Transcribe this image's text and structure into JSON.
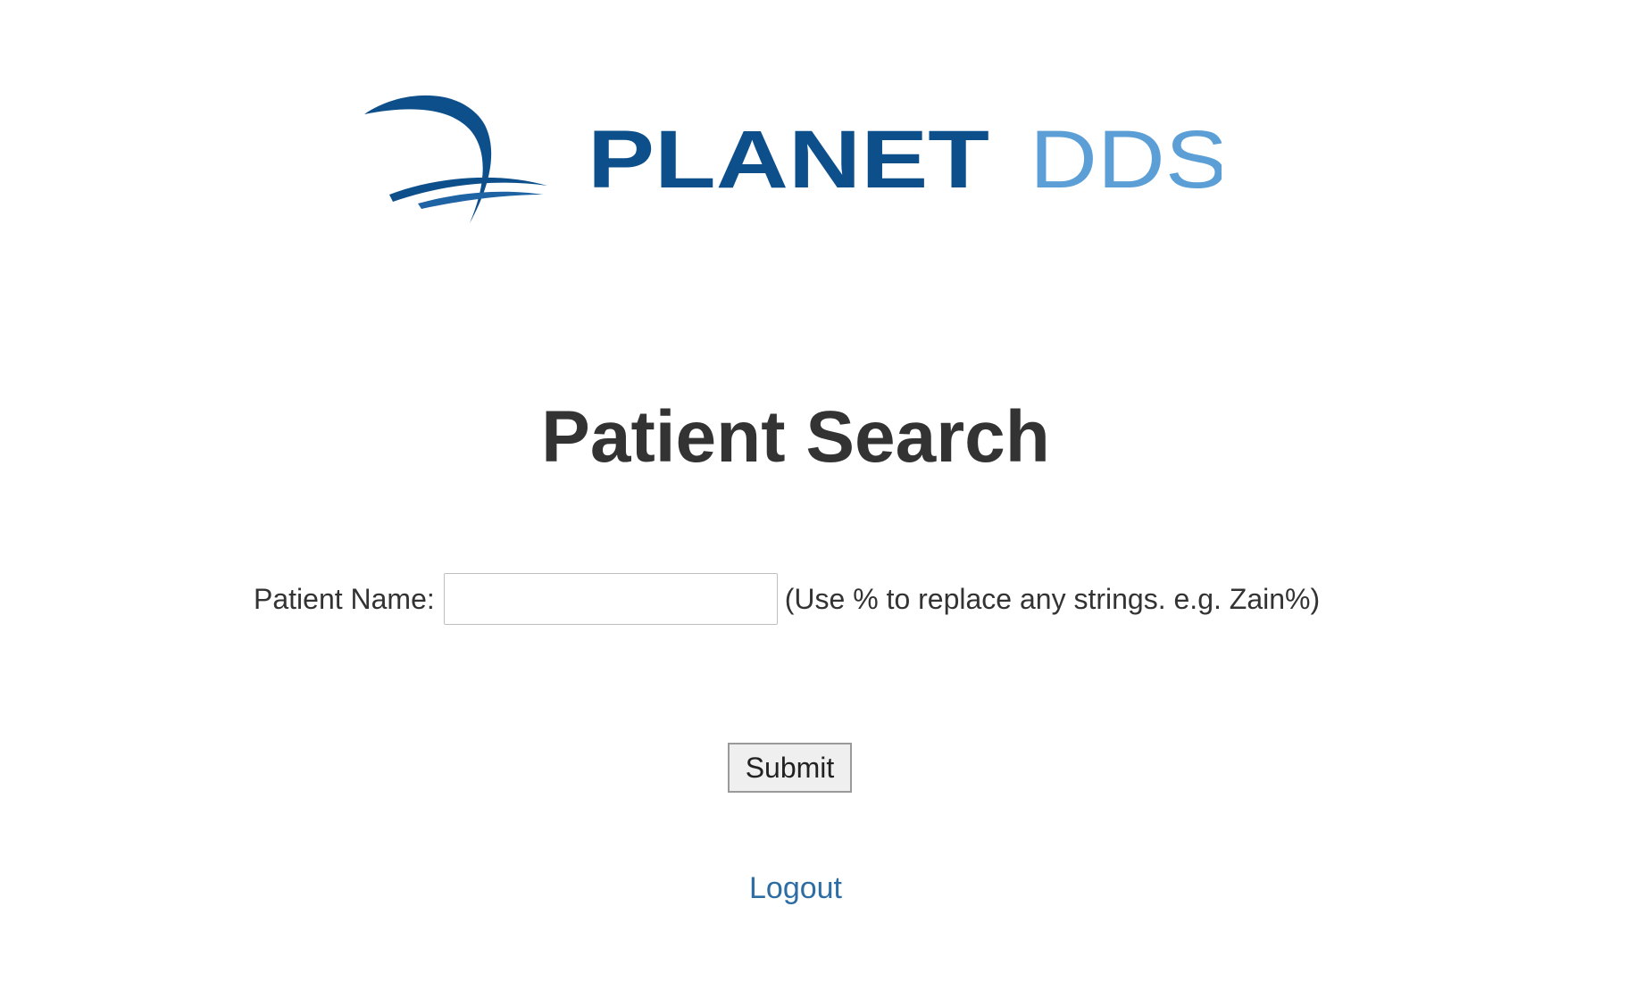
{
  "logo": {
    "brand_primary": "PLANET",
    "brand_secondary": "DDS",
    "color_primary": "#0d4f8b",
    "color_secondary": "#5b9fd6"
  },
  "page": {
    "title": "Patient Search"
  },
  "search_form": {
    "patient_name_label": "Patient Name:",
    "patient_name_value": "",
    "hint": "(Use % to replace any strings. e.g. Zain%)",
    "submit_label": "Submit"
  },
  "footer": {
    "logout_label": "Logout"
  },
  "colors": {
    "link": "#2e6da4",
    "text": "#333333"
  }
}
